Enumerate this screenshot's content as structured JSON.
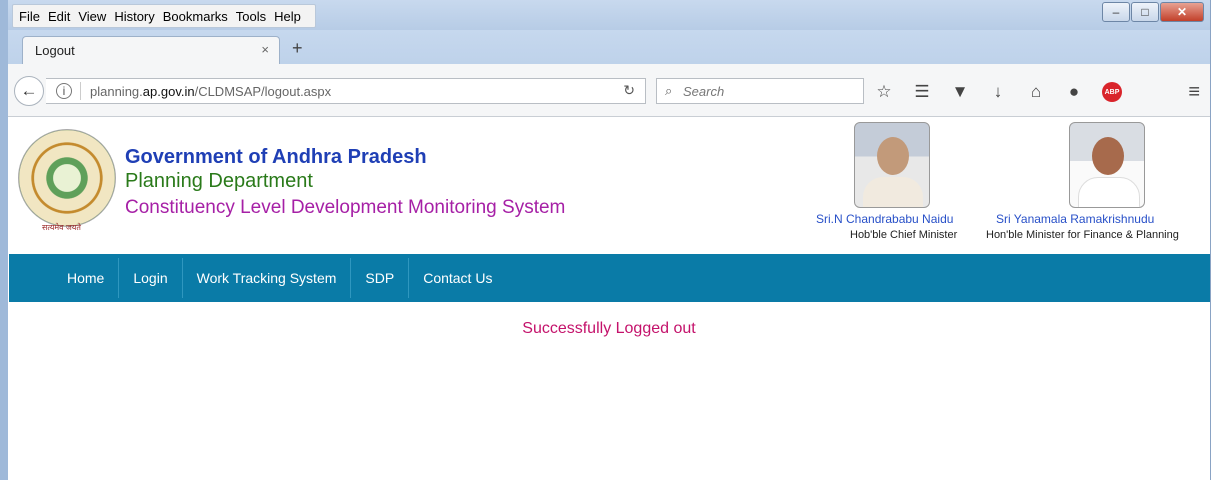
{
  "browser": {
    "menu": [
      "File",
      "Edit",
      "View",
      "History",
      "Bookmarks",
      "Tools",
      "Help"
    ],
    "window_controls": {
      "minimize": "–",
      "maximize": "□",
      "close": "✕"
    },
    "tab": {
      "title": "Logout",
      "close": "×",
      "new_tab": "+"
    },
    "url": {
      "prefix": "planning.",
      "domain": "ap.gov.in",
      "path": "/CLDMSAP/logout.aspx"
    },
    "search_placeholder": "Search",
    "icons": [
      "back-arrow-icon",
      "info-icon",
      "reload-icon",
      "search-icon",
      "star-icon",
      "reading-list-icon",
      "pocket-icon",
      "download-icon",
      "home-icon",
      "chat-icon",
      "adblock-icon",
      "menu-icon"
    ],
    "abp_label": "ABP"
  },
  "header": {
    "seal_caption": "सत्यमेव जयते",
    "title": "Government of Andhra Pradesh",
    "department": "Planning Department",
    "system": "Constituency Level Development Monitoring System",
    "officials": [
      {
        "name": "Sri.N Chandrababu Naidu",
        "role": "Hob'ble Chief Minister"
      },
      {
        "name": "Sri Yanamala Ramakrishnudu",
        "role": "Hon'ble Minister for Finance & Planning"
      }
    ]
  },
  "nav": {
    "items": [
      "Home",
      "Login",
      "Work Tracking System",
      "SDP",
      "Contact Us"
    ],
    "color": "#0a7ba7"
  },
  "main": {
    "message": "Successfully Logged out",
    "message_color": "#c4126b"
  }
}
